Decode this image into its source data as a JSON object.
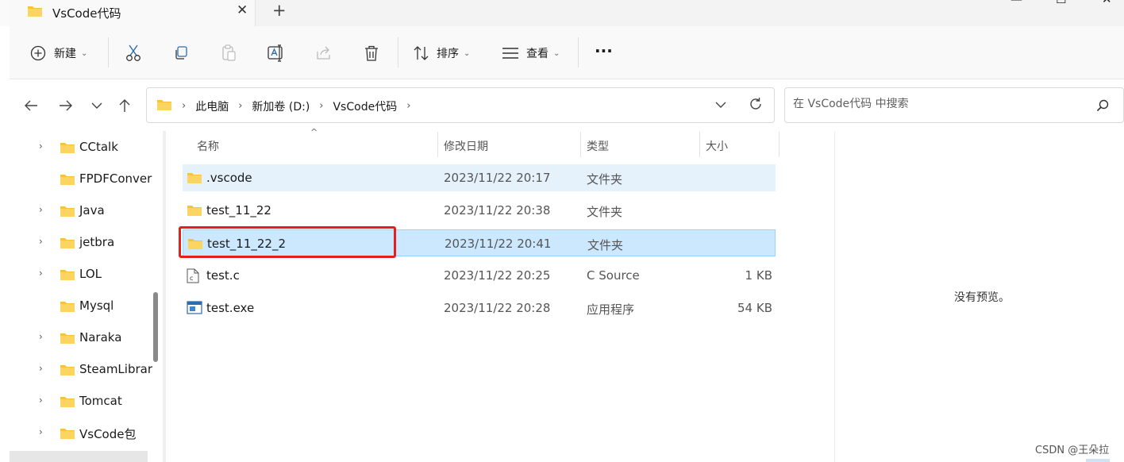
{
  "window": {
    "tab_title": "VsCode代码",
    "tab_close_glyph": "✕",
    "new_tab_glyph": "+",
    "minimize_glyph": "—",
    "maximize_glyph": "☐",
    "close_glyph": "✕"
  },
  "toolbar": {
    "new_label": "新建",
    "sort_label": "排序",
    "view_label": "查看",
    "more_label": "···",
    "dropdown_glyph": "⌄"
  },
  "address": {
    "crumbs": [
      "此电脑",
      "新加卷 (D:)",
      "VsCode代码"
    ],
    "sep_glyph": "›"
  },
  "search": {
    "placeholder": "在 VsCode代码 中搜索"
  },
  "tree": {
    "items": [
      {
        "label": "CCtalk",
        "expandable": true
      },
      {
        "label": "FPDFConver",
        "expandable": false
      },
      {
        "label": "Java",
        "expandable": true
      },
      {
        "label": "jetbra",
        "expandable": true
      },
      {
        "label": "LOL",
        "expandable": true
      },
      {
        "label": "Mysql",
        "expandable": false
      },
      {
        "label": "Naraka",
        "expandable": true
      },
      {
        "label": "SteamLibrar",
        "expandable": true
      },
      {
        "label": "Tomcat",
        "expandable": true
      },
      {
        "label": "VsCode包",
        "expandable": true
      }
    ],
    "expand_glyph": "›"
  },
  "filelist": {
    "columns": {
      "name": "名称",
      "date": "修改日期",
      "type": "类型",
      "size": "大小"
    },
    "sort_glyph": "^",
    "rows": [
      {
        "name": ".vscode",
        "date": "2023/11/22 20:17",
        "type": "文件夹",
        "size": "",
        "icon": "folder-icon",
        "state": "hover"
      },
      {
        "name": "test_11_22",
        "date": "2023/11/22 20:38",
        "type": "文件夹",
        "size": "",
        "icon": "folder-icon",
        "state": ""
      },
      {
        "name": "test_11_22_2",
        "date": "2023/11/22 20:41",
        "type": "文件夹",
        "size": "",
        "icon": "folder-icon",
        "state": "selected"
      },
      {
        "name": "test.c",
        "date": "2023/11/22 20:25",
        "type": "C Source",
        "size": "1 KB",
        "icon": "c-file-icon",
        "state": ""
      },
      {
        "name": "test.exe",
        "date": "2023/11/22 20:28",
        "type": "应用程序",
        "size": "54 KB",
        "icon": "exe-file-icon",
        "state": ""
      }
    ]
  },
  "preview": {
    "text": "没有预览。"
  },
  "watermark": "CSDN @王朵拉",
  "colors": {
    "folder": "#f8c33a",
    "selection": "#cce8ff",
    "hover": "#e5f1fb",
    "highlight_box": "#e3201c"
  }
}
